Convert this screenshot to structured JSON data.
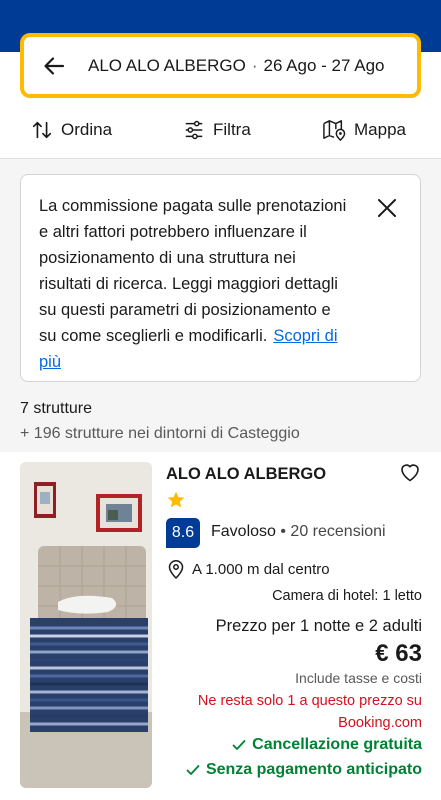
{
  "colors": {
    "brand": "#003b95",
    "accent": "#febb02",
    "link": "#006ce4",
    "warning": "#d4111e",
    "success": "#008234"
  },
  "search": {
    "hotel": "ALO ALO ALBERGO",
    "separator": "·",
    "dates": "26 Ago - 27 Ago",
    "back_icon": "arrow-left-icon"
  },
  "toolbar": {
    "sort_label": "Ordina",
    "filter_label": "Filtra",
    "map_label": "Mappa"
  },
  "notice": {
    "text": "La commissione pagata sulle prenotazioni e altri fattori potrebbero influenzare il posizionamento di una struttura nei risultati di ricerca. Leggi maggiori dettagli su questi parametri di posizionamento e su come sceglierli e modificarli.",
    "link": "Scopri di più"
  },
  "results": {
    "count": "7 strutture",
    "nearby": "+ 196 strutture nei dintorni di Casteggio"
  },
  "property": {
    "name": "ALO ALO ALBERGO",
    "stars": 1,
    "score": "8.6",
    "score_word": "Favoloso",
    "reviews": "20 recensioni",
    "distance": "A 1.000 m dal centro",
    "room": "Camera di hotel: 1 letto",
    "nights": "Prezzo per 1 notte e 2 adulti",
    "price": "€ 63",
    "taxes": "Include tasse e costi",
    "warning_line1": "Ne resta solo 1 a questo prezzo su",
    "warning_line2": "Booking.com",
    "perk1": "Cancellazione gratuita",
    "perk2": "Senza pagamento anticipato"
  }
}
